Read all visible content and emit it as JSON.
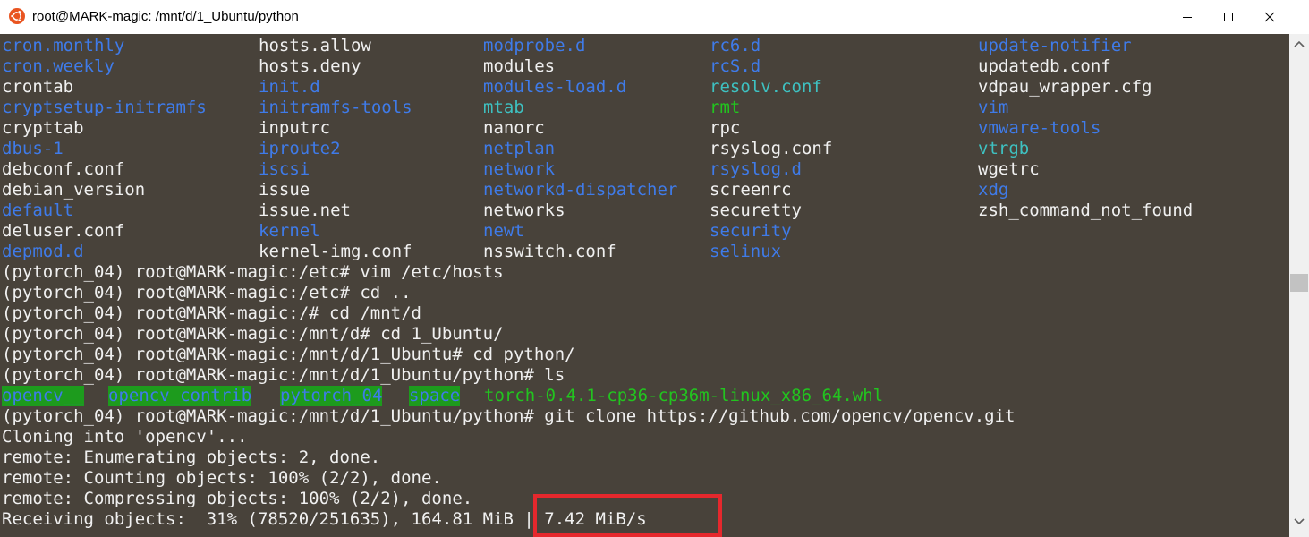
{
  "window": {
    "title": "root@MARK-magic: /mnt/d/1_Ubuntu/python",
    "app_icon": "ubuntu-icon",
    "buttons": {
      "minimize": "minimize-icon",
      "maximize": "maximize-icon",
      "close": "close-icon"
    }
  },
  "colors": {
    "terminal_bg": "#48423a",
    "directory": "#3f7be9",
    "symlink": "#3ec1c1",
    "executable": "#22c41f",
    "text": "#f0f0f0",
    "highlight_bg": "#1d9b1d",
    "annotation": "#e5282d"
  },
  "listing": {
    "rows": [
      [
        {
          "text": "cron.monthly",
          "type": "dir"
        },
        {
          "text": "hosts.allow",
          "type": "file"
        },
        {
          "text": "modprobe.d",
          "type": "dir"
        },
        {
          "text": "rc6.d",
          "type": "dir"
        },
        {
          "text": "update-notifier",
          "type": "dir"
        }
      ],
      [
        {
          "text": "cron.weekly",
          "type": "dir"
        },
        {
          "text": "hosts.deny",
          "type": "file"
        },
        {
          "text": "modules",
          "type": "file"
        },
        {
          "text": "rcS.d",
          "type": "dir"
        },
        {
          "text": "updatedb.conf",
          "type": "file"
        }
      ],
      [
        {
          "text": "crontab",
          "type": "file"
        },
        {
          "text": "init.d",
          "type": "dir"
        },
        {
          "text": "modules-load.d",
          "type": "dir"
        },
        {
          "text": "resolv.conf",
          "type": "link"
        },
        {
          "text": "vdpau_wrapper.cfg",
          "type": "file"
        }
      ],
      [
        {
          "text": "cryptsetup-initramfs",
          "type": "dir"
        },
        {
          "text": "initramfs-tools",
          "type": "dir"
        },
        {
          "text": "mtab",
          "type": "link"
        },
        {
          "text": "rmt",
          "type": "exec"
        },
        {
          "text": "vim",
          "type": "dir"
        }
      ],
      [
        {
          "text": "crypttab",
          "type": "file"
        },
        {
          "text": "inputrc",
          "type": "file"
        },
        {
          "text": "nanorc",
          "type": "file"
        },
        {
          "text": "rpc",
          "type": "file"
        },
        {
          "text": "vmware-tools",
          "type": "dir"
        }
      ],
      [
        {
          "text": "dbus-1",
          "type": "dir"
        },
        {
          "text": "iproute2",
          "type": "dir"
        },
        {
          "text": "netplan",
          "type": "dir"
        },
        {
          "text": "rsyslog.conf",
          "type": "file"
        },
        {
          "text": "vtrgb",
          "type": "link"
        }
      ],
      [
        {
          "text": "debconf.conf",
          "type": "file"
        },
        {
          "text": "iscsi",
          "type": "dir"
        },
        {
          "text": "network",
          "type": "dir"
        },
        {
          "text": "rsyslog.d",
          "type": "dir"
        },
        {
          "text": "wgetrc",
          "type": "file"
        }
      ],
      [
        {
          "text": "debian_version",
          "type": "file"
        },
        {
          "text": "issue",
          "type": "file"
        },
        {
          "text": "networkd-dispatcher",
          "type": "dir"
        },
        {
          "text": "screenrc",
          "type": "file"
        },
        {
          "text": "xdg",
          "type": "dir"
        }
      ],
      [
        {
          "text": "default",
          "type": "dir"
        },
        {
          "text": "issue.net",
          "type": "file"
        },
        {
          "text": "networks",
          "type": "file"
        },
        {
          "text": "securetty",
          "type": "file"
        },
        {
          "text": "zsh_command_not_found",
          "type": "file"
        }
      ],
      [
        {
          "text": "deluser.conf",
          "type": "file"
        },
        {
          "text": "kernel",
          "type": "dir"
        },
        {
          "text": "newt",
          "type": "dir"
        },
        {
          "text": "security",
          "type": "dir"
        },
        {
          "text": "",
          "type": "file"
        }
      ],
      [
        {
          "text": "depmod.d",
          "type": "dir"
        },
        {
          "text": "kernel-img.conf",
          "type": "file"
        },
        {
          "text": "nsswitch.conf",
          "type": "file"
        },
        {
          "text": "selinux",
          "type": "dir"
        },
        {
          "text": "",
          "type": "file"
        }
      ]
    ]
  },
  "commands": [
    "(pytorch_04) root@MARK-magic:/etc# vim /etc/hosts",
    "(pytorch_04) root@MARK-magic:/etc# cd ..",
    "(pytorch_04) root@MARK-magic:/# cd /mnt/d",
    "(pytorch_04) root@MARK-magic:/mnt/d# cd 1_Ubuntu/",
    "(pytorch_04) root@MARK-magic:/mnt/d/1_Ubuntu# cd python/",
    "(pytorch_04) root@MARK-magic:/mnt/d/1_Ubuntu/python# ls"
  ],
  "ls_output": [
    {
      "text": "opencv__",
      "type": "highlight"
    },
    {
      "text": "opencv_contrib",
      "type": "highlight"
    },
    {
      "text": "pytorch_04",
      "type": "highlight"
    },
    {
      "text": "space",
      "type": "highlight"
    },
    {
      "text": "torch-0.4.1-cp36-cp36m-linux_x86_64.whl",
      "type": "exec"
    }
  ],
  "git_output": [
    "(pytorch_04) root@MARK-magic:/mnt/d/1_Ubuntu/python# git clone https://github.com/opencv/opencv.git",
    "Cloning into 'opencv'...",
    "remote: Enumerating objects: 2, done.",
    "remote: Counting objects: 100% (2/2), done.",
    "remote: Compressing objects: 100% (2/2), done.",
    "Receiving objects:  31% (78520/251635), 164.81 MiB | 7.42 MiB/s"
  ],
  "scrollbar": {
    "up": "scroll-up-arrow-icon",
    "down": "scroll-down-arrow-icon"
  }
}
